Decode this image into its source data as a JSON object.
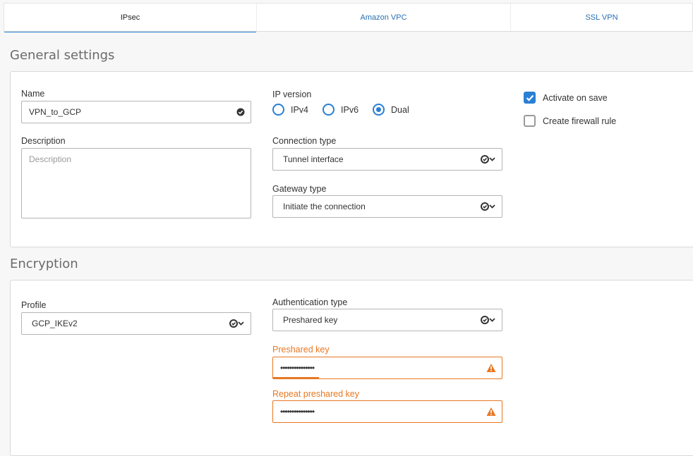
{
  "tabs": [
    {
      "label": "IPsec",
      "active": true
    },
    {
      "label": "Amazon VPC",
      "active": false
    },
    {
      "label": "SSL VPN",
      "active": false
    }
  ],
  "general": {
    "title": "General settings",
    "name_label": "Name",
    "name_value": "VPN_to_GCP",
    "description_label": "Description",
    "description_placeholder": "Description",
    "ip_version_label": "IP version",
    "ip_options": [
      {
        "label": "IPv4",
        "selected": false
      },
      {
        "label": "IPv6",
        "selected": false
      },
      {
        "label": "Dual",
        "selected": true
      }
    ],
    "connection_type_label": "Connection type",
    "connection_type_value": "Tunnel interface",
    "gateway_type_label": "Gateway type",
    "gateway_type_value": "Initiate the connection",
    "activate_label": "Activate on save",
    "activate_checked": true,
    "firewall_label": "Create firewall rule",
    "firewall_checked": false
  },
  "encryption": {
    "title": "Encryption",
    "profile_label": "Profile",
    "profile_value": "GCP_IKEv2",
    "auth_type_label": "Authentication type",
    "auth_type_value": "Preshared key",
    "psk_label": "Preshared key",
    "psk_value": "•••••••••••••••",
    "repeat_psk_label": "Repeat preshared key",
    "repeat_psk_value": "•••••••••••••••",
    "psk_strength": 0.2
  },
  "colors": {
    "accent": "#2a7fd4",
    "warning": "#e87722"
  }
}
